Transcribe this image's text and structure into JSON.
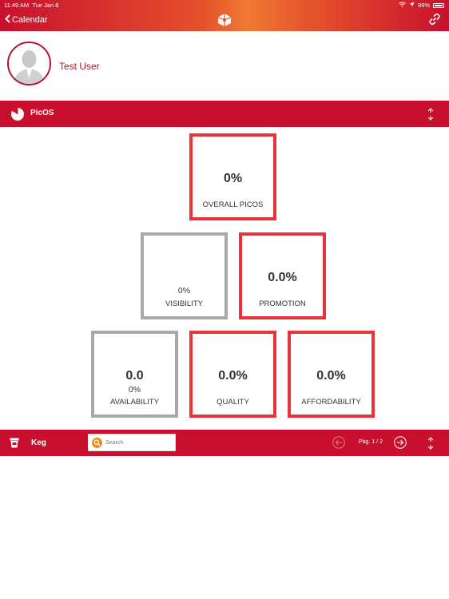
{
  "status_bar": {
    "time": "11:49 AM",
    "date": "Tue Jan 8",
    "battery": "99%"
  },
  "nav": {
    "back_label": "Calendar",
    "logo_icon": "logo-icon",
    "link_icon": "link-icon"
  },
  "profile": {
    "name": "Test User"
  },
  "picos": {
    "title": "PicOS",
    "tiles": {
      "overall": {
        "value": "0%",
        "label": "OVERALL PICOS",
        "state": "red"
      },
      "visibility": {
        "value": "0%",
        "label": "VISIBILITY",
        "state": "gray"
      },
      "promotion": {
        "value": "0.0%",
        "label": "PROMOTION",
        "state": "red"
      },
      "availability": {
        "value": "0.0",
        "sub": "0%",
        "label": "AVAILABILITY",
        "state": "gray"
      },
      "quality": {
        "value": "0.0%",
        "label": "QUALITY",
        "state": "red"
      },
      "affordability": {
        "value": "0.0%",
        "label": "AFFORDABILITY",
        "state": "red"
      }
    }
  },
  "keg": {
    "title": "Keg",
    "search_placeholder": "Search",
    "page_label": "Pág. 1 / 2"
  },
  "colors": {
    "brand_red": "#c8102e",
    "tile_red": "#e8333a",
    "tile_gray": "#a8a8a8",
    "accent_orange": "#f08c1a"
  }
}
